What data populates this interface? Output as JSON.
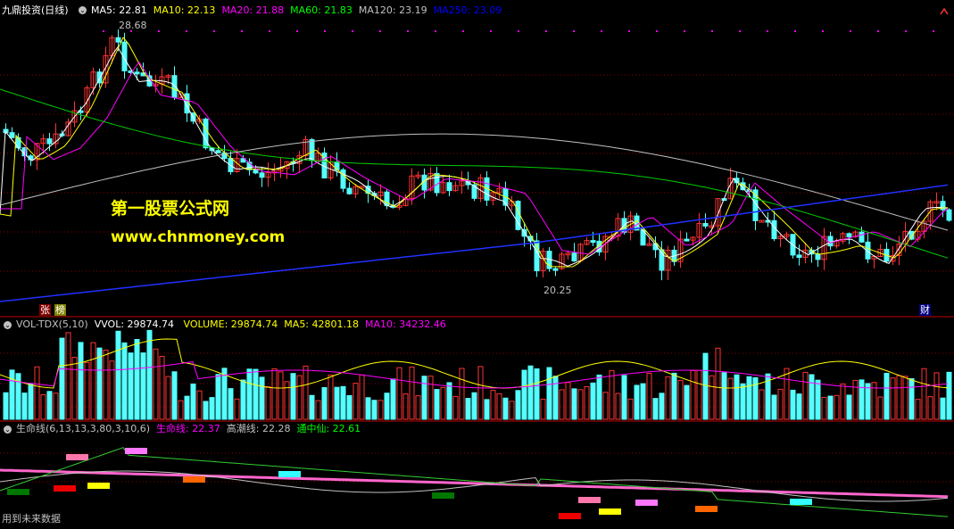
{
  "main_panel": {
    "title": "九鼎投资(日线)",
    "indicators": [
      {
        "label": "MA5: 22.81",
        "color": "#ffffff"
      },
      {
        "label": "MA10: 22.13",
        "color": "#ffff00"
      },
      {
        "label": "MA20: 21.88",
        "color": "#ff00ff"
      },
      {
        "label": "MA60: 21.83",
        "color": "#00ff00"
      },
      {
        "label": "MA120: 23.19",
        "color": "#c0c0c0"
      },
      {
        "label": "MA250: 23.09",
        "color": "#0000ff"
      }
    ],
    "high_label": "28.68",
    "low_label": "20.25",
    "watermark_title": "第一股票公式网",
    "watermark_url": "www.chnmoney.com",
    "markers": {
      "zhang": "张",
      "bang": "榜",
      "cai": "财"
    }
  },
  "volume_panel": {
    "name": "VOL-TDX(5,10)",
    "items": [
      {
        "label": "VVOL: 29874.74",
        "color": "#ffffff"
      },
      {
        "label": "VOLUME: 29874.74",
        "color": "#ffff00"
      },
      {
        "label": "MA5: 42801.18",
        "color": "#ffff00"
      },
      {
        "label": "MA10: 34232.46",
        "color": "#ff00ff"
      }
    ]
  },
  "life_panel": {
    "name": "生命线(6,13,13,3,80,3,10,6)",
    "items": [
      {
        "label": "生命线: 22.37",
        "color": "#ff00ff"
      },
      {
        "label": "高潮线: 22.28",
        "color": "#c0c0c0"
      },
      {
        "label": "通中仙: 22.61",
        "color": "#00ff00"
      }
    ],
    "footer": "用到未来数据"
  },
  "colors": {
    "up": "#ff3333",
    "down": "#55ffff",
    "grid": "#880000",
    "background": "#000000"
  }
}
